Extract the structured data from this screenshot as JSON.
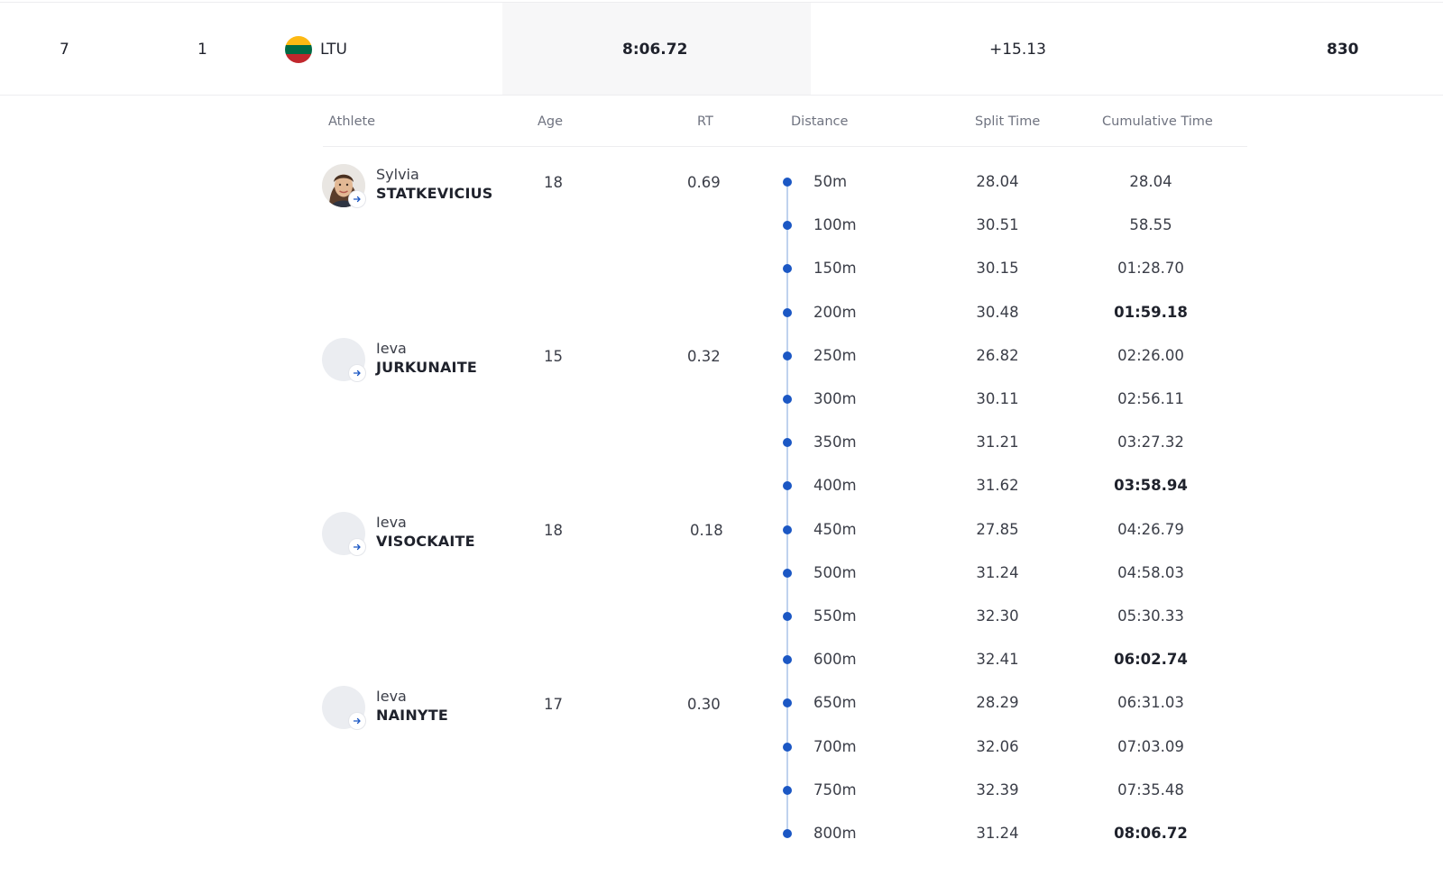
{
  "result": {
    "rank": "7",
    "lane": "1",
    "country": "LTU",
    "time": "8:06.72",
    "behind": "+15.13",
    "points": "830",
    "flag_colors": [
      "#FDB913",
      "#006A44",
      "#C1272D"
    ]
  },
  "table_headers": {
    "athlete": "Athlete",
    "age": "Age",
    "rt": "RT",
    "distance": "Distance",
    "split_time": "Split Time",
    "cumulative_time": "Cumulative Time"
  },
  "athletes": [
    {
      "first_name": "Sylvia",
      "last_name": "STATKEVICIUS",
      "age": "18",
      "rt": "0.69",
      "avatar": "photo"
    },
    {
      "first_name": "Ieva",
      "last_name": "JURKUNAITE",
      "age": "15",
      "rt": "0.32",
      "avatar": "placeholder"
    },
    {
      "first_name": "Ieva",
      "last_name": "VISOCKAITE",
      "age": "18",
      "rt": "0.18",
      "avatar": "placeholder"
    },
    {
      "first_name": "Ieva",
      "last_name": "NAINYTE",
      "age": "17",
      "rt": "0.30",
      "avatar": "placeholder"
    }
  ],
  "splits": [
    {
      "distance": "50m",
      "split": "28.04",
      "cumulative": "28.04",
      "bold": false
    },
    {
      "distance": "100m",
      "split": "30.51",
      "cumulative": "58.55",
      "bold": false
    },
    {
      "distance": "150m",
      "split": "30.15",
      "cumulative": "01:28.70",
      "bold": false
    },
    {
      "distance": "200m",
      "split": "30.48",
      "cumulative": "01:59.18",
      "bold": true
    },
    {
      "distance": "250m",
      "split": "26.82",
      "cumulative": "02:26.00",
      "bold": false
    },
    {
      "distance": "300m",
      "split": "30.11",
      "cumulative": "02:56.11",
      "bold": false
    },
    {
      "distance": "350m",
      "split": "31.21",
      "cumulative": "03:27.32",
      "bold": false
    },
    {
      "distance": "400m",
      "split": "31.62",
      "cumulative": "03:58.94",
      "bold": true
    },
    {
      "distance": "450m",
      "split": "27.85",
      "cumulative": "04:26.79",
      "bold": false
    },
    {
      "distance": "500m",
      "split": "31.24",
      "cumulative": "04:58.03",
      "bold": false
    },
    {
      "distance": "550m",
      "split": "32.30",
      "cumulative": "05:30.33",
      "bold": false
    },
    {
      "distance": "600m",
      "split": "32.41",
      "cumulative": "06:02.74",
      "bold": true
    },
    {
      "distance": "650m",
      "split": "28.29",
      "cumulative": "06:31.03",
      "bold": false
    },
    {
      "distance": "700m",
      "split": "32.06",
      "cumulative": "07:03.09",
      "bold": false
    },
    {
      "distance": "750m",
      "split": "32.39",
      "cumulative": "07:35.48",
      "bold": false
    },
    {
      "distance": "800m",
      "split": "31.24",
      "cumulative": "08:06.72",
      "bold": true
    }
  ],
  "colors": {
    "timeline_dot": "#1B57C4",
    "timeline_line": "#BFD2EE",
    "highlight_cell": "#F7F7F8"
  },
  "icons": {
    "athlete_link": "arrow-right-icon"
  }
}
